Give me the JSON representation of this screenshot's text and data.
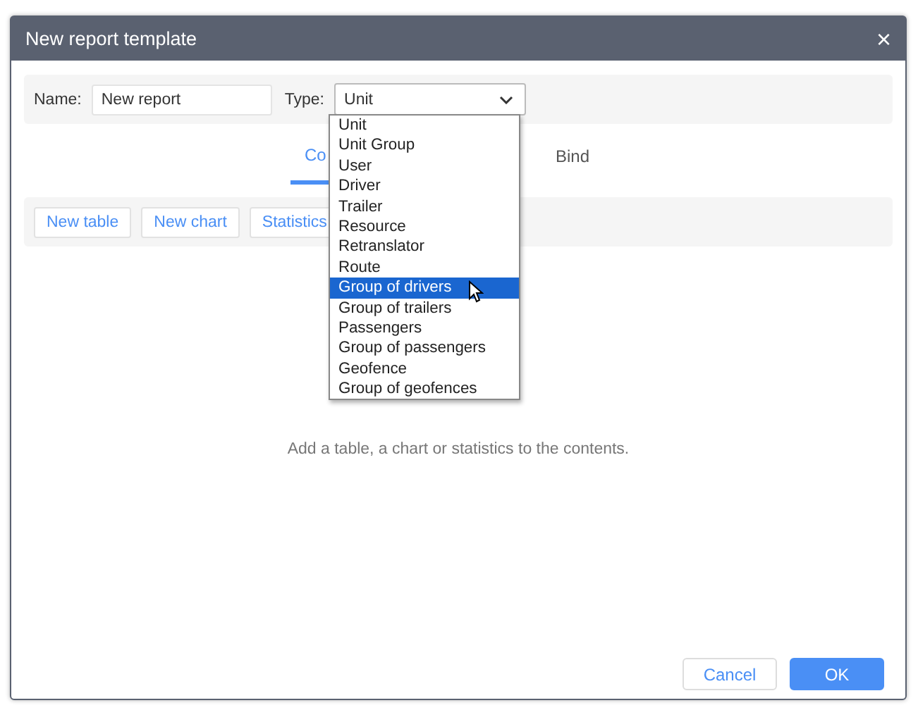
{
  "dialog": {
    "title": "New report template",
    "close": "×"
  },
  "name_field": {
    "label": "Name:",
    "value": "New report"
  },
  "type_field": {
    "label": "Type:",
    "value": "Unit"
  },
  "tabs": [
    {
      "label": "Co",
      "selected": true
    },
    {
      "label": "Bind",
      "selected": false
    }
  ],
  "toolbar": [
    "New table",
    "New chart",
    "Statistics"
  ],
  "dropdown": [
    {
      "label": "Unit",
      "selected": false
    },
    {
      "label": "Unit Group",
      "selected": false
    },
    {
      "label": "User",
      "selected": false
    },
    {
      "label": "Driver",
      "selected": false
    },
    {
      "label": "Trailer",
      "selected": false
    },
    {
      "label": "Resource",
      "selected": false
    },
    {
      "label": "Retranslator",
      "selected": false
    },
    {
      "label": "Route",
      "selected": false
    },
    {
      "label": "Group of drivers",
      "selected": true
    },
    {
      "label": "Group of trailers",
      "selected": false
    },
    {
      "label": "Passengers",
      "selected": false
    },
    {
      "label": "Group of passengers",
      "selected": false
    },
    {
      "label": "Geofence",
      "selected": false
    },
    {
      "label": "Group of geofences",
      "selected": false
    }
  ],
  "empty_message": "Add a table, a chart or statistics to the contents.",
  "buttons": [
    {
      "label": "Cancel",
      "kind": "secondary"
    },
    {
      "label": "OK",
      "kind": "primary"
    }
  ]
}
